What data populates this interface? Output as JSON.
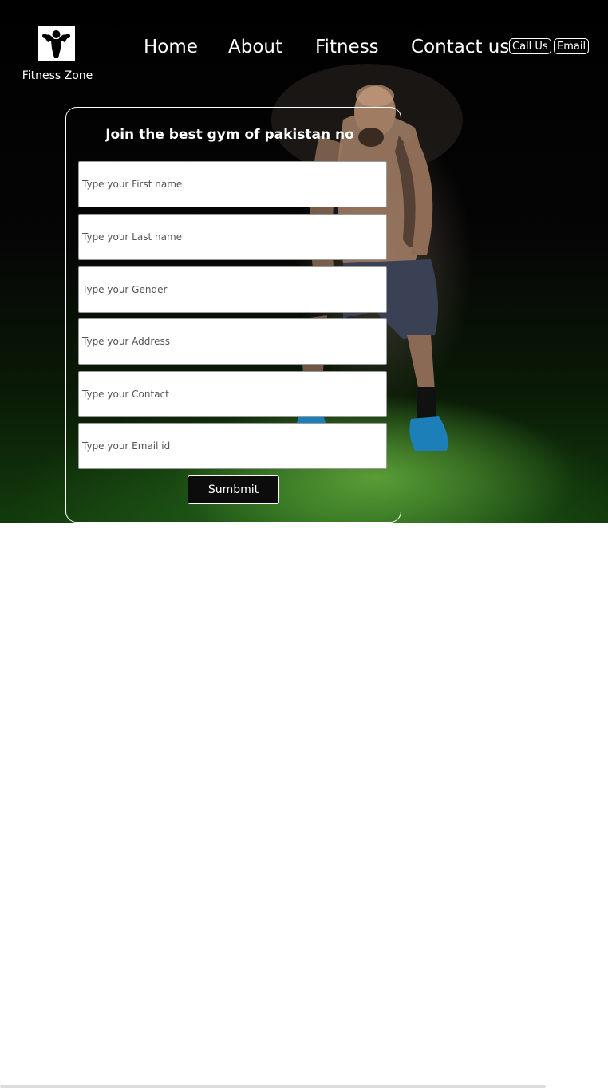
{
  "brand": {
    "name": "Fitness Zone",
    "logo_icon": "flexing-bodybuilder-icon"
  },
  "nav": {
    "items": [
      "Home",
      "About",
      "Fitness",
      "Contact us"
    ],
    "call_label": "Call Us",
    "email_label": "Email"
  },
  "form": {
    "title": "Join the best gym of pakistan no",
    "fields": [
      {
        "placeholder": "Type your First name",
        "value": ""
      },
      {
        "placeholder": "Type your Last name",
        "value": ""
      },
      {
        "placeholder": "Type your Gender",
        "value": ""
      },
      {
        "placeholder": "Type your Address",
        "value": ""
      },
      {
        "placeholder": "Type your Contact",
        "value": ""
      },
      {
        "placeholder": "Type your Email id",
        "value": ""
      }
    ],
    "submit_label": "Sumbmit"
  },
  "colors": {
    "background": "#000000",
    "text": "#ffffff",
    "turf": "#3f8a22",
    "page": "#ffffff"
  }
}
